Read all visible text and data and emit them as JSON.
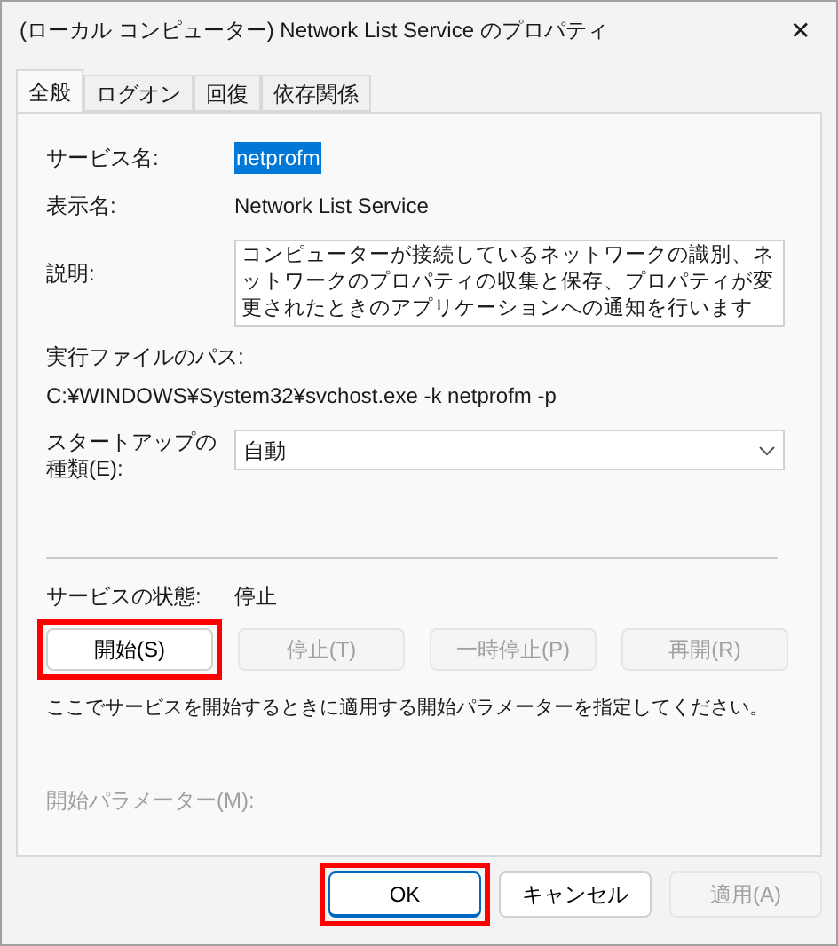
{
  "window": {
    "title": "(ローカル コンピューター) Network List Service のプロパティ",
    "close": "✕"
  },
  "tabs": [
    {
      "label": "全般",
      "selected": true
    },
    {
      "label": "ログオン",
      "selected": false
    },
    {
      "label": "回復",
      "selected": false
    },
    {
      "label": "依存関係",
      "selected": false
    }
  ],
  "service_name": {
    "label": "サービス名:",
    "value": "netprofm",
    "selected": true
  },
  "display_name": {
    "label": "表示名:",
    "value": "Network List Service"
  },
  "description": {
    "label": "説明:",
    "value": "コンピューターが接続しているネットワークの識別、ネットワークのプロパティの収集と保存、プロパティが変更されたときのアプリケーションへの通知を行います"
  },
  "executable_path": {
    "label": "実行ファイルのパス:",
    "value": "C:¥WINDOWS¥System32¥svchost.exe -k netprofm -p"
  },
  "startup_type": {
    "label_lines": [
      "スタートアップの",
      "種類(E):"
    ],
    "value": "自動"
  },
  "service_status": {
    "label": "サービスの状態:",
    "value": "停止"
  },
  "service_buttons": [
    {
      "label": "開始(S)",
      "disabled": false,
      "highlighted": true
    },
    {
      "label": "停止(T)",
      "disabled": true,
      "highlighted": false
    },
    {
      "label": "一時停止(P)",
      "disabled": true,
      "highlighted": false
    },
    {
      "label": "再開(R)",
      "disabled": true,
      "highlighted": false
    }
  ],
  "hint": "ここでサービスを開始するときに適用する開始パラメーターを指定してください。",
  "start_parameters": {
    "label": "開始パラメーター(M):",
    "disabled": true
  },
  "dialog_buttons": [
    {
      "label": "OK",
      "disabled": false,
      "highlighted": true,
      "default": true
    },
    {
      "label": "キャンセル",
      "disabled": false,
      "highlighted": false,
      "default": false
    },
    {
      "label": "適用(A)",
      "disabled": true,
      "highlighted": false,
      "default": false
    }
  ]
}
